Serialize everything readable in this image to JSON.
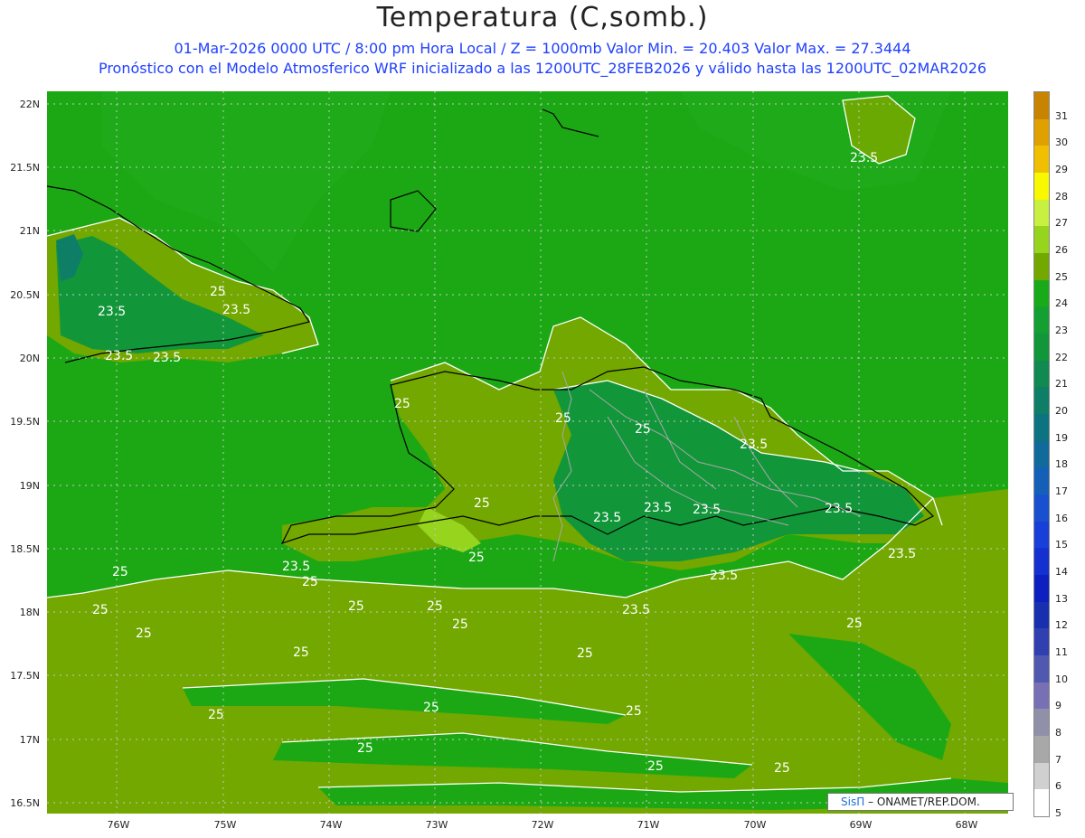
{
  "header": {
    "title": "Temperatura (C,somb.)",
    "subtitle1": "01-Mar-2026  0000 UTC / 8:00 pm Hora Local / Z = 1000mb    Valor Min. = 20.403  Valor Max. = 27.3444",
    "subtitle2": "Pronóstico con el Modelo Atmosferico WRF inicializado a las 1200UTC_28FEB2026 y válido hasta las  1200UTC_02MAR2026"
  },
  "map": {
    "lat_labels": [
      "22N",
      "21.5N",
      "21N",
      "20.5N",
      "20N",
      "19.5N",
      "19N",
      "18.5N",
      "18N",
      "17.5N",
      "17N",
      "16.5N"
    ],
    "lon_labels": [
      "76W",
      "75W",
      "74W",
      "73W",
      "72W",
      "71W",
      "70W",
      "69W",
      "68W"
    ],
    "contour_labels": [
      {
        "text": "23.5",
        "id": "c1"
      },
      {
        "text": "23.5",
        "id": "c2"
      },
      {
        "text": "23.5",
        "id": "c3"
      },
      {
        "text": "23.5",
        "id": "c4"
      },
      {
        "text": "25",
        "id": "c5"
      },
      {
        "text": "25",
        "id": "c6"
      },
      {
        "text": "25",
        "id": "c7"
      },
      {
        "text": "23.5",
        "id": "c8"
      },
      {
        "text": "25",
        "id": "c9"
      },
      {
        "text": "23.5",
        "id": "c10"
      },
      {
        "text": "23.5",
        "id": "c11"
      },
      {
        "text": "23.5",
        "id": "c12"
      },
      {
        "text": "23.5",
        "id": "c13"
      },
      {
        "text": "23.5",
        "id": "c14"
      },
      {
        "text": "23.5",
        "id": "c15"
      },
      {
        "text": "25",
        "id": "c16"
      },
      {
        "text": "25",
        "id": "c17"
      },
      {
        "text": "25",
        "id": "c18"
      },
      {
        "text": "25",
        "id": "c19"
      },
      {
        "text": "25",
        "id": "c20"
      },
      {
        "text": "25",
        "id": "c21"
      },
      {
        "text": "25",
        "id": "c22"
      },
      {
        "text": "25",
        "id": "c23"
      },
      {
        "text": "25",
        "id": "c24"
      },
      {
        "text": "25",
        "id": "c25"
      },
      {
        "text": "25",
        "id": "c26"
      },
      {
        "text": "25",
        "id": "c27"
      },
      {
        "text": "25",
        "id": "c28"
      },
      {
        "text": "23.5",
        "id": "c29"
      },
      {
        "text": "23.5",
        "id": "c30"
      },
      {
        "text": "25",
        "id": "c31"
      },
      {
        "text": "25",
        "id": "c32"
      },
      {
        "text": "25",
        "id": "c33"
      },
      {
        "text": "25",
        "id": "c34"
      },
      {
        "text": "25",
        "id": "c35"
      },
      {
        "text": "23.5",
        "id": "c36"
      }
    ]
  },
  "colorbar": {
    "levels": [
      {
        "label": "31",
        "color": "#c88400"
      },
      {
        "label": "30",
        "color": "#e0a000"
      },
      {
        "label": "29",
        "color": "#f0c000"
      },
      {
        "label": "28",
        "color": "#f8f800"
      },
      {
        "label": "27",
        "color": "#c8f040"
      },
      {
        "label": "26",
        "color": "#96d41e"
      },
      {
        "label": "25",
        "color": "#72a800"
      },
      {
        "label": "24",
        "color": "#18aa18"
      },
      {
        "label": "23",
        "color": "#14a030"
      },
      {
        "label": "22",
        "color": "#12963a"
      },
      {
        "label": "21",
        "color": "#108a50"
      },
      {
        "label": "20",
        "color": "#0e7e66"
      },
      {
        "label": "19",
        "color": "#0c7480"
      },
      {
        "label": "18",
        "color": "#106a9c"
      },
      {
        "label": "17",
        "color": "#1460b8"
      },
      {
        "label": "16",
        "color": "#1850d0"
      },
      {
        "label": "15",
        "color": "#1840d8"
      },
      {
        "label": "14",
        "color": "#1430d0"
      },
      {
        "label": "13",
        "color": "#0c20c0"
      },
      {
        "label": "12",
        "color": "#1830b0"
      },
      {
        "label": "11",
        "color": "#3040b0"
      },
      {
        "label": "10",
        "color": "#5058b0"
      },
      {
        "label": "9",
        "color": "#7870b4"
      },
      {
        "label": "8",
        "color": "#9090a8"
      },
      {
        "label": "7",
        "color": "#a8a8a8"
      },
      {
        "label": "6",
        "color": "#d0d0d0"
      },
      {
        "label": "5",
        "color": "#ffffff"
      }
    ]
  },
  "credit": {
    "brand": "SisΠ",
    "org": " – ONAMET/REP.DOM."
  },
  "colors": {
    "ocean_green": "#1ca814",
    "warm_olive": "#72a800",
    "cool_teal": "#12963a",
    "title_blue": "#1f3fff"
  }
}
